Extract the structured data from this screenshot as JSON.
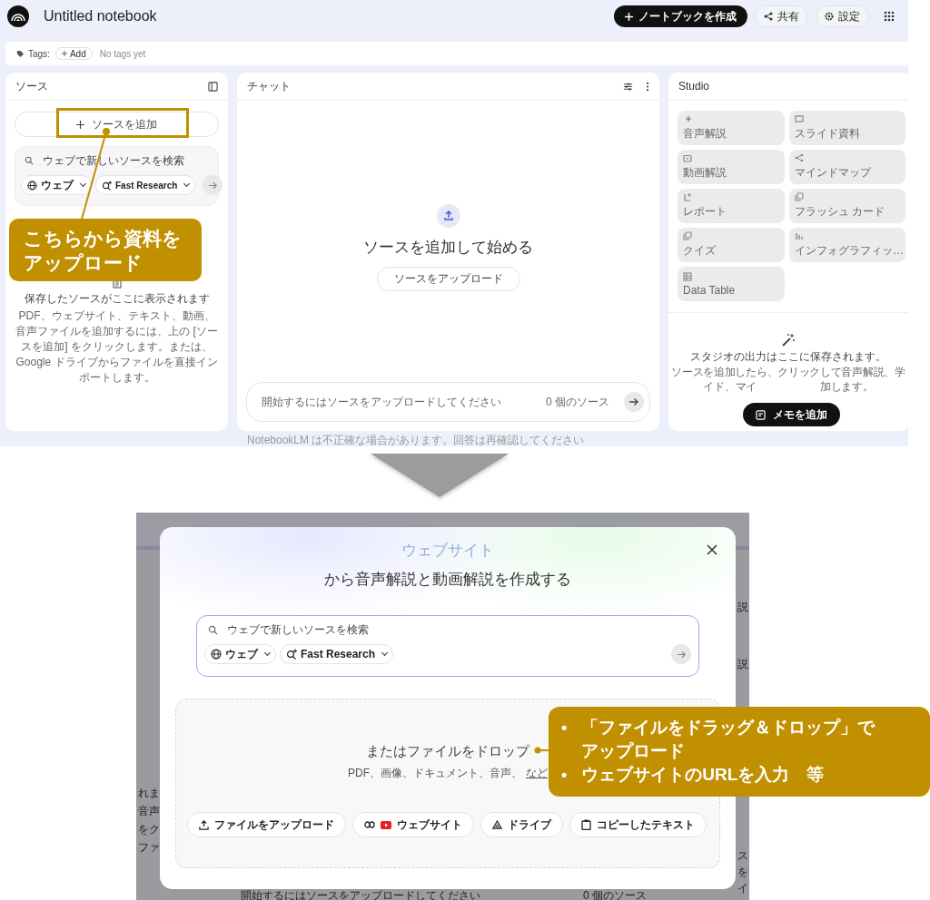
{
  "top_screenshot": {
    "header": {
      "title": "Untitled notebook",
      "create_button": "ノートブックを作成",
      "share_button": "共有",
      "settings_button": "設定"
    },
    "tags_bar": {
      "label": "Tags:",
      "add_button": "Add",
      "empty_text": "No tags yet"
    },
    "sources_panel": {
      "title": "ソース",
      "add_button": "ソースを追加",
      "search": {
        "placeholder": "ウェブで新しいソースを検索",
        "source_chip": "ウェブ",
        "mode_chip": "Fast Research"
      },
      "empty_title": "保存したソースがここに表示されます",
      "empty_text": "PDF、ウェブサイト、テキスト、動画、音声ファイルを追加するには、上の [ソースを追加] をクリックします。または、Google ドライブからファイルを直接インポートします。"
    },
    "chat_panel": {
      "title": "チャット",
      "empty_title": "ソースを追加して始める",
      "upload_button": "ソースをアップロード",
      "input": {
        "placeholder": "開始するにはソースをアップロードしてください"
      },
      "source_count": "0 個のソース",
      "footer_note": "NotebookLM は不正確な場合があります。回答は再確認してください"
    },
    "studio_panel": {
      "title": "Studio",
      "tiles": [
        {
          "kind": "sparkle",
          "label": "音声解説"
        },
        {
          "kind": "slides",
          "label": "スライド資料"
        },
        {
          "kind": "video",
          "label": "動画解説"
        },
        {
          "kind": "mindmap",
          "label": "マインドマップ"
        },
        {
          "kind": "report",
          "label": "レポート"
        },
        {
          "kind": "flashcards",
          "label": "フラッシュ カード"
        },
        {
          "kind": "quiz",
          "label": "クイズ"
        },
        {
          "kind": "infographic",
          "label": "インフォグラフィッ…"
        },
        {
          "kind": "table",
          "label": "Data Table"
        }
      ],
      "empty_title": "スタジオの出力はここに保存されます。",
      "empty_line": "ソースを追加したら、クリックして音声解説、学",
      "empty_line_left": "イド、マイ",
      "empty_line_right": "加します。",
      "add_note_button": "メモを追加"
    }
  },
  "top_callout": {
    "lines": [
      "こちらから資料を",
      "アップロード"
    ]
  },
  "bottom_screenshot": {
    "backdrop_texts": {
      "left": [
        "れま",
        "音声",
        "をク",
        "ファ"
      ],
      "right": [
        "説",
        "説"
      ],
      "right_bottom": [
        "ス",
        "を",
        "イ"
      ],
      "chat_input": "開始するにはソースをアップロードしてください",
      "source_count": "0 個のソース"
    },
    "dialog": {
      "title_highlight": "ウェブサイト",
      "title": "から音声解説と動画解説を作成する",
      "search": {
        "placeholder": "ウェブで新しいソースを検索",
        "source_chip": "ウェブ",
        "mode_chip": "Fast Research"
      },
      "drop_title": "またはファイルをドロップ",
      "drop_types": "PDF、画像、ドキュメント、音声、",
      "drop_more_link": "など",
      "buttons": [
        {
          "kind": "upload",
          "label": "ファイルをアップロード"
        },
        {
          "kind": "website",
          "label": "ウェブサイト"
        },
        {
          "kind": "drive",
          "label": "ドライブ"
        },
        {
          "kind": "clipboard",
          "label": "コピーしたテキスト"
        }
      ]
    }
  },
  "bottom_callout": {
    "items": [
      {
        "bullet": "•",
        "text": "「ファイルをドラッグ＆ドロップ」でアップロード"
      },
      {
        "bullet": "•",
        "text": "ウェブサイトのURLを入力　等"
      }
    ]
  }
}
